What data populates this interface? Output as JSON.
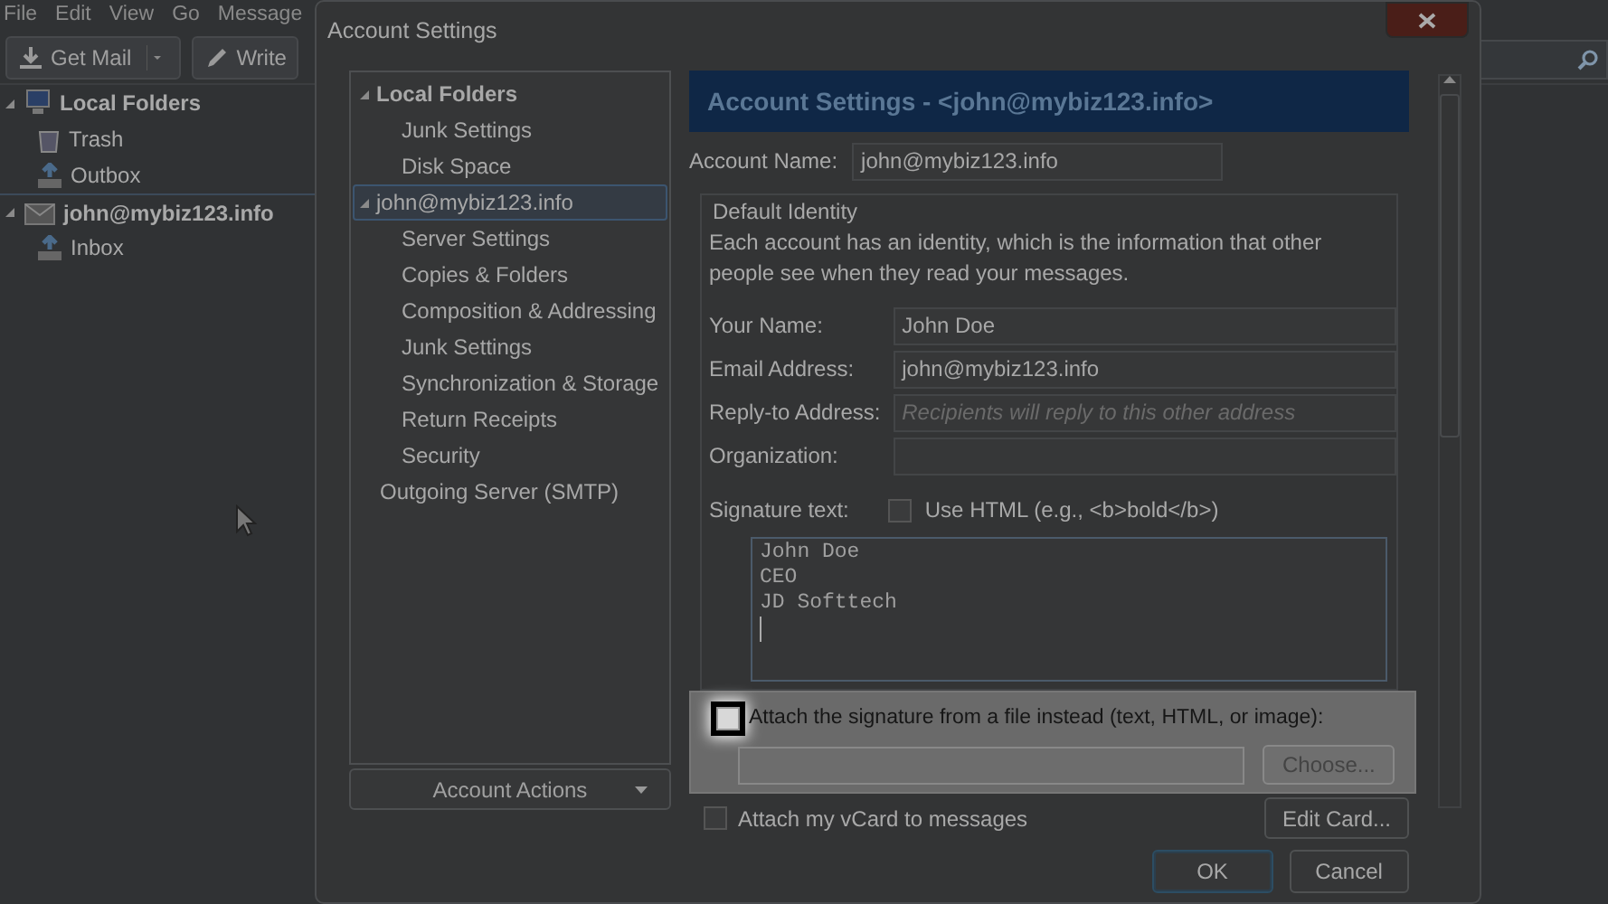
{
  "app": {
    "menu": [
      "File",
      "Edit",
      "View",
      "Go",
      "Message"
    ],
    "toolbar": [
      {
        "label": "Get Mail",
        "kind": "split"
      },
      {
        "label": "Write",
        "kind": "plain"
      }
    ],
    "folders": [
      {
        "label": "Local Folders",
        "expanded": true,
        "children": [
          {
            "label": "Trash"
          },
          {
            "label": "Outbox"
          }
        ]
      },
      {
        "label": "john@mybiz123.info",
        "expanded": true,
        "children": [
          {
            "label": "Inbox"
          }
        ]
      }
    ]
  },
  "dialog": {
    "title": "Account Settings",
    "tree": [
      {
        "label": "Local Folders",
        "expanded": true,
        "selected": false,
        "children": [
          {
            "label": "Junk Settings",
            "selected": false
          },
          {
            "label": "Disk Space",
            "selected": false
          }
        ]
      },
      {
        "label": "john@mybiz123.info",
        "expanded": true,
        "selected": true,
        "children": [
          {
            "label": "Server Settings",
            "selected": false
          },
          {
            "label": "Copies & Folders",
            "selected": false
          },
          {
            "label": "Composition & Addressing",
            "selected": false
          },
          {
            "label": "Junk Settings",
            "selected": false
          },
          {
            "label": "Synchronization & Storage",
            "selected": false
          },
          {
            "label": "Return Receipts",
            "selected": false
          },
          {
            "label": "Security",
            "selected": false
          }
        ]
      },
      {
        "label": "Outgoing Server (SMTP)",
        "selected": false
      }
    ],
    "account_actions": "Account Actions",
    "heading": "Account Settings - <john@mybiz123.info>",
    "account_name": {
      "label": "Account Name:",
      "value": "john@mybiz123.info"
    },
    "identity": {
      "legend": "Default Identity",
      "description": "Each account has an identity, which is the information that other people see when they read your messages.",
      "fields": [
        {
          "label": "Your Name:",
          "value": "John Doe"
        },
        {
          "label": "Email Address:",
          "value": "john@mybiz123.info"
        },
        {
          "label": "Reply-to Address:",
          "placeholder": "Recipients will reply to this other address"
        },
        {
          "label": "Organization:"
        }
      ]
    },
    "signature": {
      "label": "Signature text:",
      "use_html": {
        "label": "Use HTML (e.g., <b>bold</b>)",
        "checked": false
      },
      "text": "John Doe\nCEO\nJD Softtech"
    },
    "attach_file": {
      "label": "Attach the signature from a file instead (text, HTML, or image):",
      "checked": false,
      "highlighted": true,
      "choose": "Choose..."
    },
    "vcard": {
      "label": "Attach my vCard to messages",
      "checked": false,
      "edit": "Edit Card..."
    },
    "buttons": [
      {
        "label": "OK",
        "kind": "default"
      },
      {
        "label": "Cancel",
        "kind": "normal"
      }
    ]
  }
}
